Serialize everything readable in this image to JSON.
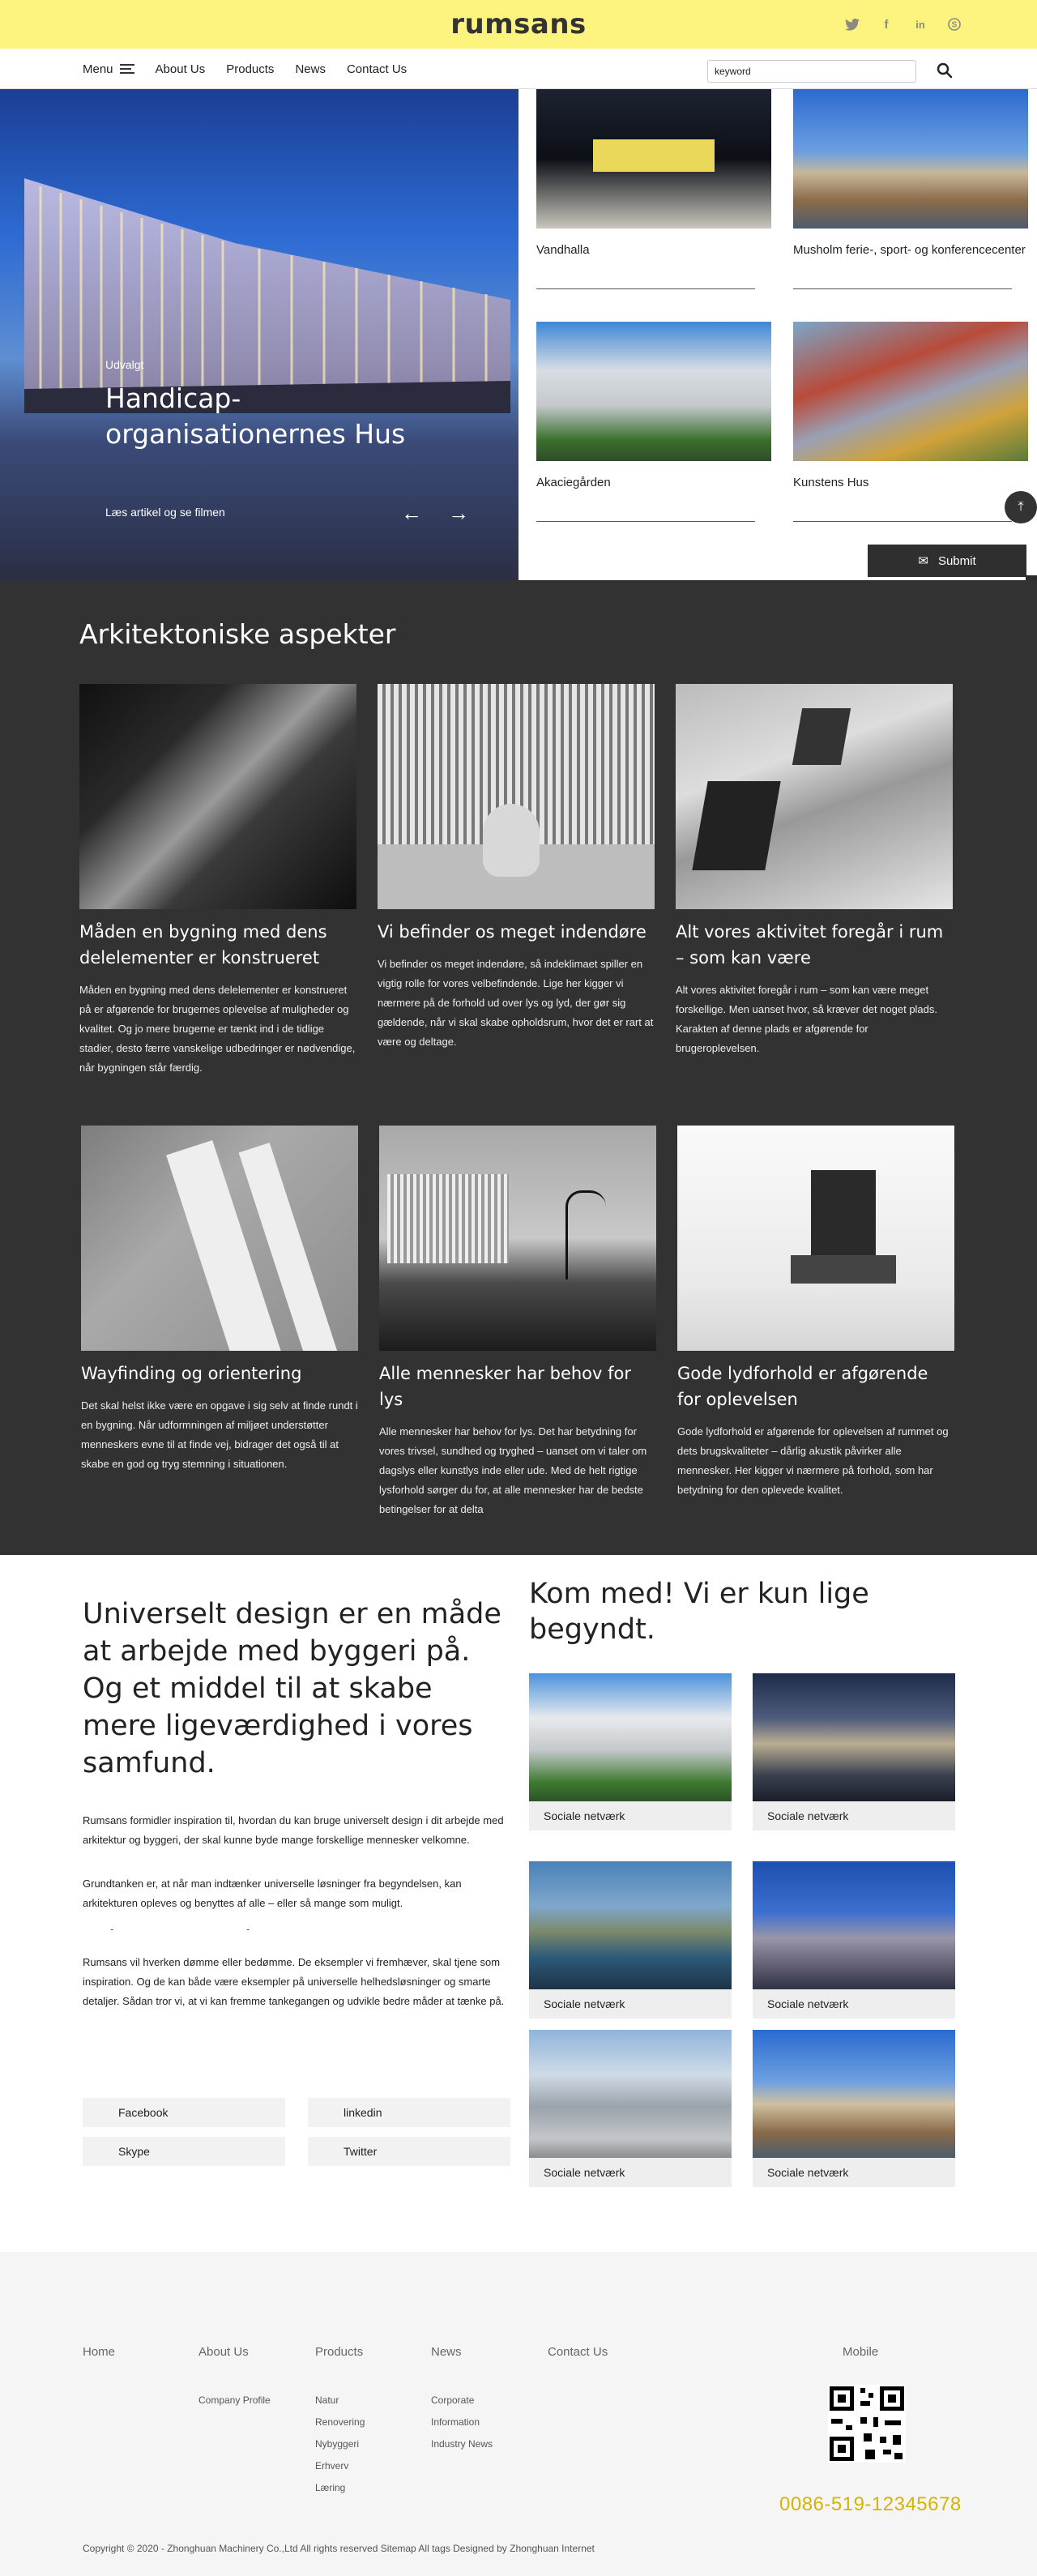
{
  "header": {
    "logo": "rumsans",
    "social_icons": [
      "twitter-icon",
      "facebook-icon",
      "linkedin-icon",
      "skype-icon"
    ]
  },
  "nav": {
    "menu_label": "Menu",
    "items": [
      "About Us",
      "Products",
      "News",
      "Contact Us"
    ],
    "search_value": "keyword"
  },
  "hero": {
    "label": "Udvalgt",
    "title": "Handicap-organisationernes Hus",
    "link": "Læs artikel og se filmen",
    "prev_symbol": "←",
    "next_symbol": "→",
    "cards": [
      {
        "title": "Vandhalla"
      },
      {
        "title": "Musholm ferie-, sport- og konferencecenter"
      },
      {
        "title": "Akaciegården"
      },
      {
        "title": "Kunstens Hus"
      }
    ]
  },
  "floating": {
    "submit_label": "Submit"
  },
  "aspects": {
    "heading": "Arkitektoniske aspekter",
    "items": [
      {
        "title": "Måden en bygning med dens delelementer er konstrueret",
        "text": "Måden en bygning med dens delelementer er konstrueret på er afgørende for brugernes oplevelse af muligheder og kvalitet. Og jo mere brugerne er tænkt ind i de tidlige stadier, desto færre vanskelige udbedringer er nødvendige, når bygningen står færdig."
      },
      {
        "title": "Vi befinder os meget indendøre",
        "text": "Vi befinder os meget indendøre, så indeklimaet spiller en vigtig rolle for vores velbefindende. Lige her kigger vi nærmere på de forhold ud over lys og lyd, der gør sig gældende, når vi skal skabe opholdsrum, hvor det er rart at være og deltage."
      },
      {
        "title": "Alt vores aktivitet foregår i rum – som kan være",
        "text": "Alt vores aktivitet foregår i rum – som kan være meget forskellige. Men uanset hvor, så kræver det noget plads. Karakten af denne plads er afgørende for brugeroplevelsen."
      },
      {
        "title": "Wayfinding og orientering",
        "text": "Det skal helst ikke være en opgave i sig selv at finde rundt i en bygning. Når udformningen af miljøet understøtter menneskers evne til at finde vej, bidrager det også til at skabe en god og tryg stemning i situationen."
      },
      {
        "title": "Alle mennesker har behov for lys",
        "text": "Alle mennesker har behov for lys. Det har betydning for vores trivsel, sundhed og tryghed – uanset om vi taler om dagslys eller kunstlys inde eller ude. Med de helt rigtige lysforhold sørger du for, at alle mennesker har de bedste betingelser for at delta"
      },
      {
        "title": "Gode lydforhold er afgørende for oplevelsen",
        "text": "Gode lydforhold er afgørende for oplevelsen af rummet og dets brugskvaliteter – dårlig akustik påvirker alle mennesker. Her kigger vi nærmere på forhold, som har betydning for den oplevede kvalitet."
      }
    ]
  },
  "universal": {
    "heading": "Universelt design er en måde at arbejde med byggeri på. Og et middel til at skabe mere ligeværdighed i vores samfund.",
    "p1": "Rumsans formidler inspiration til, hvordan du kan bruge universelt design i dit arbejde med arkitektur og byggeri, der skal kunne byde mange forskellige mennesker velkomne.",
    "p2": "Grundtanken er, at når man indtænker universelle løsninger fra begyndelsen, kan arkitekturen opleves og benyttes af alle – eller så mange som muligt.",
    "dashes": "- -",
    "p3": "Rumsans vil hverken dømme eller bedømme. De eksempler vi fremhæver, skal tjene som inspiration. Og de kan både være eksempler på universelle helhedsløsninger og smarte detaljer. Sådan tror vi, at vi kan fremme tankegangen og udvikle bedre måder at tænke på.",
    "share": [
      "Facebook",
      "linkedin",
      "Skype",
      "Twitter"
    ]
  },
  "network": {
    "heading": "Kom med! Vi er kun lige begyndt.",
    "tiles": [
      "Sociale netværk",
      "Sociale netværk",
      "Sociale netværk",
      "Sociale netværk",
      "Sociale netværk",
      "Sociale netværk"
    ]
  },
  "footer": {
    "home": "Home",
    "about": {
      "head": "About Us",
      "items": [
        "Company Profile"
      ]
    },
    "products": {
      "head": "Products",
      "items": [
        "Natur",
        "Renovering",
        "Nybyggeri",
        "Erhverv",
        "Læring"
      ]
    },
    "news": {
      "head": "News",
      "items": [
        "Corporate",
        "Information",
        "Industry News"
      ]
    },
    "contact": "Contact Us",
    "mobile": "Mobile",
    "phone": "0086-519-12345678",
    "copyright": "Copyright © 2020 - Zhonghuan Machinery Co.,Ltd All rights reserved   Sitemap All tags Designed by Zhonghuan Internet"
  },
  "colors": {
    "topbar": "#fdf37f",
    "dark_section": "#323232",
    "phone": "#d4b400"
  }
}
